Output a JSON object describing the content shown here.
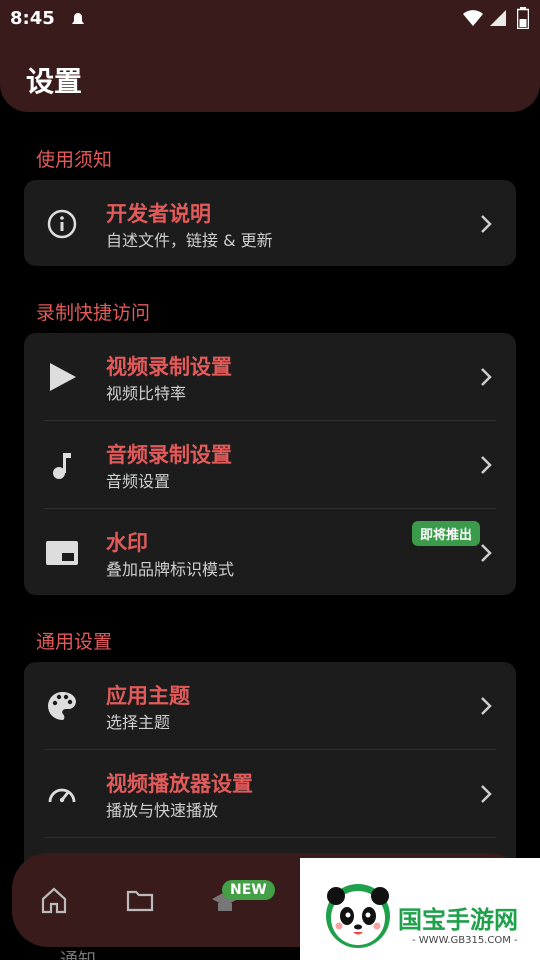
{
  "status": {
    "time": "8:45"
  },
  "header": {
    "title": "设置"
  },
  "sections": [
    {
      "title": "使用须知",
      "items": [
        {
          "title": "开发者说明",
          "subtitle": "自述文件，链接 & 更新",
          "icon": "info-icon"
        }
      ]
    },
    {
      "title": "录制快捷访问",
      "items": [
        {
          "title": "视频录制设置",
          "subtitle": "视频比特率",
          "icon": "play-icon"
        },
        {
          "title": "音频录制设置",
          "subtitle": "音频设置",
          "icon": "music-note-icon"
        },
        {
          "title": "水印",
          "subtitle": "叠加品牌标识模式",
          "icon": "watermark-icon",
          "badge": "即将推出"
        }
      ]
    },
    {
      "title": "通用设置",
      "items": [
        {
          "title": "应用主题",
          "subtitle": "选择主题",
          "icon": "palette-icon"
        },
        {
          "title": "视频播放器设置",
          "subtitle": "播放与快速播放",
          "icon": "speedometer-icon"
        }
      ]
    }
  ],
  "bottom_nav": {
    "new_badge": "NEW",
    "partial_text": "通知"
  },
  "watermark_overlay": {
    "brand": "国宝手游网",
    "url": "- WWW.GB315.COM -"
  },
  "colors": {
    "accent": "#e35a5a",
    "header_bg": "#3a1b1b",
    "card_bg": "#1c1c1c",
    "badge_green": "#3a9b4a"
  }
}
